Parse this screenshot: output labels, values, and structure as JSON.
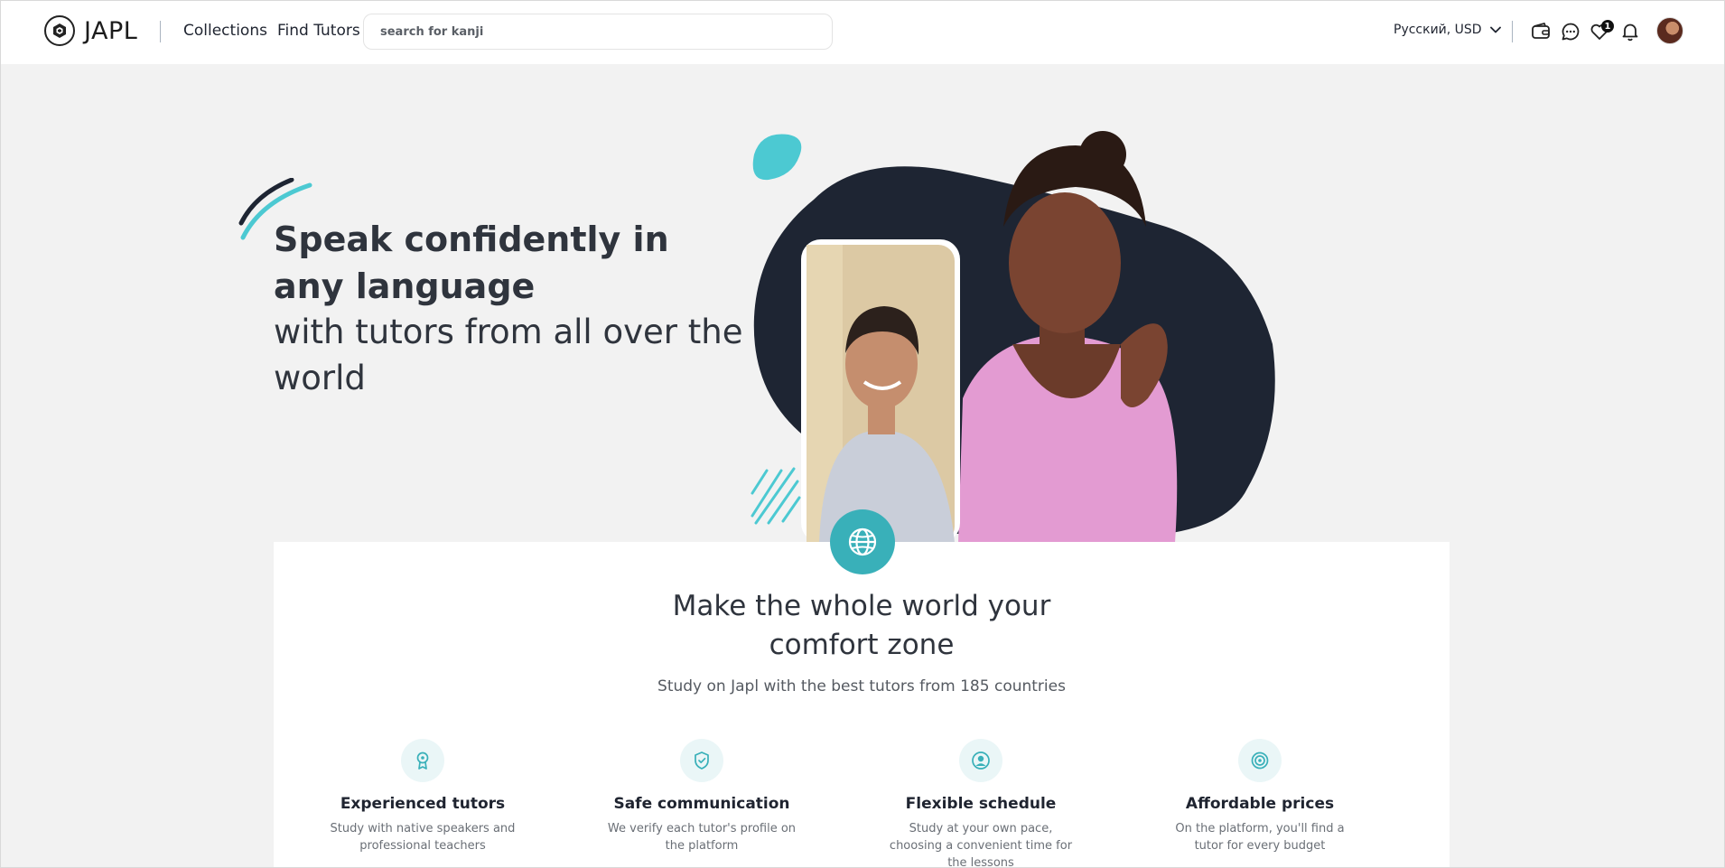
{
  "header": {
    "logo_text": "JAPL",
    "nav": {
      "collections": "Collections",
      "find_tutors": "Find Tutors"
    },
    "search": {
      "placeholder": "search for kanji"
    },
    "locale": "Русский, USD",
    "icons": [
      "wallet-icon",
      "chat-icon",
      "heart-icon",
      "bell-icon"
    ],
    "favorites_badge": "1"
  },
  "hero": {
    "title": "Speak confidently in any language",
    "subtitle": "with tutors from all over the world"
  },
  "section": {
    "title_line1": "Make the whole world your",
    "title_line2": "comfort zone",
    "subtitle": "Study on Japl with the best tutors from 185 countries",
    "features": [
      {
        "icon": "award-icon",
        "title": "Experienced tutors",
        "desc": "Study with native speakers and professional teachers"
      },
      {
        "icon": "shield-check-icon",
        "title": "Safe communication",
        "desc": "We verify each tutor's profile on the platform"
      },
      {
        "icon": "user-circle-icon",
        "title": "Flexible schedule",
        "desc": "Study at your own pace, choosing a convenient time for the lessons"
      },
      {
        "icon": "target-icon",
        "title": "Affordable prices",
        "desc": "On the platform, you'll find a tutor for every budget"
      }
    ]
  },
  "colors": {
    "accent": "#39b0b9",
    "dark_blob": "#1e2533",
    "text": "#2f343d",
    "background": "#f2f2f2"
  }
}
